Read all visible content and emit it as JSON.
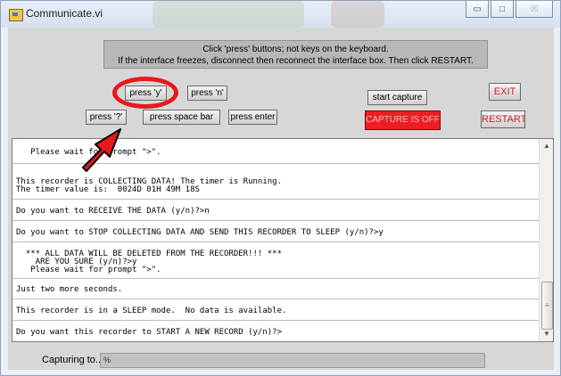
{
  "window": {
    "title": "Communicate.vi",
    "controls": {
      "minimize": "▭",
      "maximize": "□",
      "close": "☒"
    }
  },
  "notice": {
    "line1": "Click 'press' buttons; not keys on the keyboard.",
    "line2": "If the interface freezes, disconnect then reconnect the interface box. Then click RESTART."
  },
  "buttons": {
    "press_y": "press 'y'",
    "press_n": "press 'n'",
    "press_question": "press '?'",
    "press_space": "press space bar",
    "press_enter": "press enter",
    "start_capture": "start capture",
    "exit": "EXIT",
    "restart": "RESTART"
  },
  "capture_status": "CAPTURE IS OFF",
  "console": {
    "lines": [
      "   Please wait for prompt \">\".",
      "",
      "This recorder is COLLECTING DATA! The timer is Running.",
      "The timer value is:  0024D 01H 49M 18S",
      "Do you want to RECEIVE THE DATA (y/n)?>n",
      "Do you want to STOP COLLECTING DATA AND SEND THIS RECORDER TO SLEEP (y/n)?>y",
      "  *** ALL DATA WILL BE DELETED FROM THE RECORDER!!! ***",
      "    ARE YOU SURE (y/n)?>y",
      "   Please wait for prompt \">\".",
      "Just two more seconds.",
      "This recorder is in a SLEEP mode.  No data is available.",
      "Do you want this recorder to START A NEW RECORD (y/n)?>"
    ]
  },
  "scrollbar": {
    "up": "▲",
    "down": "▼",
    "grip": "≡"
  },
  "capturing": {
    "label": "Capturing to...",
    "path": "%"
  },
  "annotation": {
    "color": "#e8181c"
  }
}
